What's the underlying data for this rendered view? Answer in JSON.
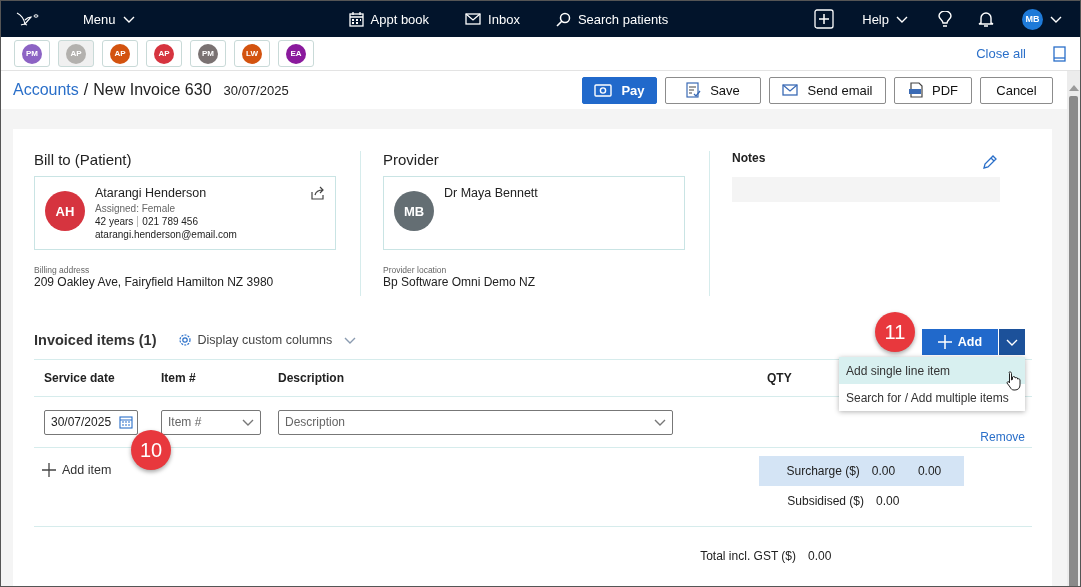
{
  "nav": {
    "menu": "Menu",
    "links": [
      {
        "label": "Appt book"
      },
      {
        "label": "Inbox"
      },
      {
        "label": "Search patients"
      }
    ],
    "help": "Help",
    "user": "MB"
  },
  "patient_tabs": [
    {
      "initials": "PM",
      "color": "#8c63c4",
      "selected": false
    },
    {
      "initials": "AP",
      "color": "#b3b1ae",
      "selected": true
    },
    {
      "initials": "AP",
      "color": "#d3530f",
      "selected": false
    },
    {
      "initials": "AP",
      "color": "#d6343f",
      "selected": false
    },
    {
      "initials": "PM",
      "color": "#7a7272",
      "selected": false
    },
    {
      "initials": "LW",
      "color": "#d3530f",
      "selected": false
    },
    {
      "initials": "EA",
      "color": "#8a1a9d",
      "selected": false
    }
  ],
  "close_all": "Close all",
  "breadcrumb": {
    "parent": "Accounts",
    "separator": "/",
    "current": "New Invoice 630",
    "date": "30/07/2025"
  },
  "actions": [
    {
      "label": "Pay",
      "kind": "pay"
    },
    {
      "label": "Save",
      "kind": "save"
    },
    {
      "label": "Send email",
      "kind": "email"
    },
    {
      "label": "PDF",
      "kind": "pdf"
    },
    {
      "label": "Cancel",
      "kind": "plain"
    }
  ],
  "bill_to": {
    "title": "Bill to (Patient)",
    "initials": "AH",
    "color": "#d6343f",
    "name": "Atarangi Henderson",
    "assigned": "Assigned: Female",
    "age": "42 years",
    "phone": "021 789 456",
    "email": "atarangi.henderson@email.com",
    "address_label": "Billing address",
    "address": "209 Oakley Ave, Fairyfield Hamilton NZ 3980"
  },
  "provider": {
    "title": "Provider",
    "initials": "MB",
    "color": "#646e73",
    "name": "Dr Maya Bennett",
    "location_label": "Provider location",
    "location": "Bp Software Omni Demo NZ"
  },
  "notes": {
    "title": "Notes"
  },
  "items": {
    "title": "Invoiced items (1)",
    "custom_columns": "Display custom columns",
    "add_button": "Add",
    "menu": [
      {
        "label": "Add single line item",
        "selected": true
      },
      {
        "label": "Search for / Add multiple items",
        "selected": false
      }
    ],
    "columns": [
      "Service date",
      "Item #",
      "Description",
      "QTY"
    ],
    "rows": [
      {
        "service_date": "30/07/2025",
        "item_placeholder": "Item #",
        "description_placeholder": "Description",
        "remove": "Remove"
      }
    ],
    "add_item": "Add item"
  },
  "totals": [
    {
      "label": "Surcharge ($)",
      "values": [
        "0.00",
        "0.00"
      ],
      "highlighted": true
    },
    {
      "label": "Subsidised ($)",
      "values": [
        "0.00"
      ],
      "highlighted": false
    },
    {
      "label": "Total incl. GST ($)",
      "values": [
        "0.00"
      ],
      "highlighted": false
    }
  ],
  "callouts": [
    {
      "number": "10"
    },
    {
      "number": "11"
    }
  ]
}
